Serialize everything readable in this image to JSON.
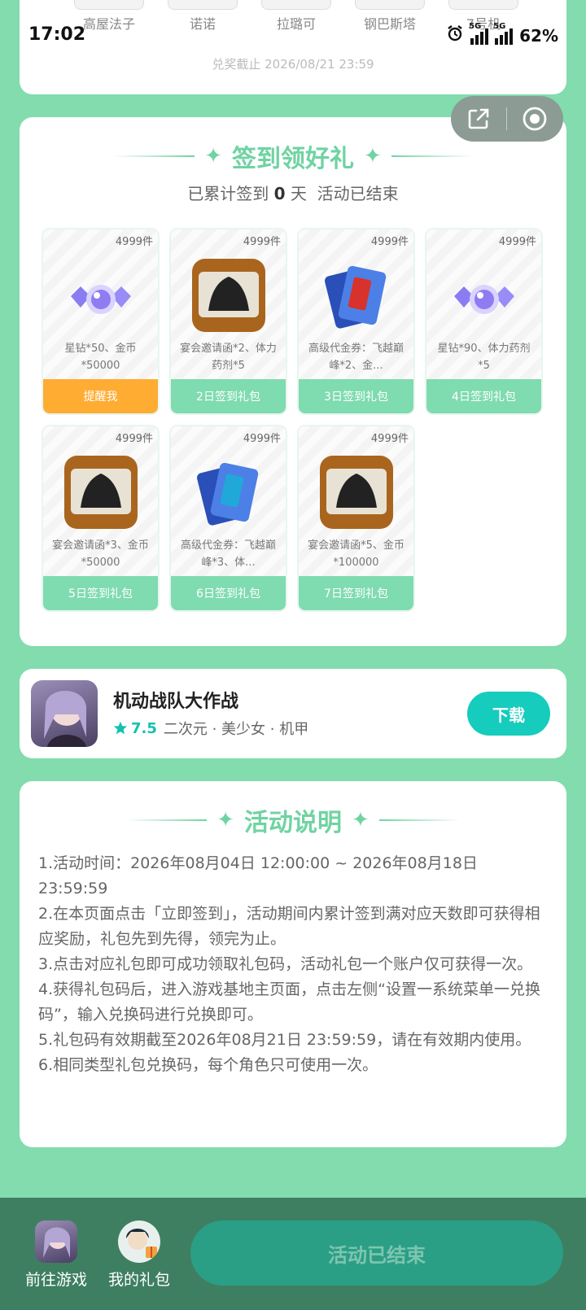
{
  "status_bar": {
    "time": "17:02",
    "battery": "62%",
    "network_tag_1": "5G",
    "network_tag_2": "5G"
  },
  "top_prizes": {
    "items": [
      "高屋法子",
      "诺诺",
      "拉璐可",
      "钢巴斯塔",
      "7号机"
    ],
    "deadline": "兑奖截止 2026/08/21 23:59"
  },
  "checkin": {
    "title": "签到领好礼",
    "sub_prefix": "已累计签到",
    "days": "0",
    "sub_unit": "天",
    "status": "活动已结束",
    "gifts": [
      {
        "count": "4999件",
        "desc": "星钻*50、金币*50000",
        "button": "提醒我",
        "icon": "diamond-icon"
      },
      {
        "count": "4999件",
        "desc": "宴会邀请函*2、体力药剂*5",
        "button": "2日签到礼包",
        "icon": "invitation-card-icon"
      },
      {
        "count": "4999件",
        "desc": "高级代金券：飞越巅峰*2、金...",
        "button": "3日签到礼包",
        "icon": "voucher-cards-icon"
      },
      {
        "count": "4999件",
        "desc": "星钻*90、体力药剂*5",
        "button": "4日签到礼包",
        "icon": "diamond-icon"
      },
      {
        "count": "4999件",
        "desc": "宴会邀请函*3、金币*50000",
        "button": "5日签到礼包",
        "icon": "invitation-card-icon"
      },
      {
        "count": "4999件",
        "desc": "高级代金券：飞越巅峰*3、体...",
        "button": "6日签到礼包",
        "icon": "voucher-cards-icon"
      },
      {
        "count": "4999件",
        "desc": "宴会邀请函*5、金币*100000",
        "button": "7日签到礼包",
        "icon": "invitation-card-icon"
      }
    ]
  },
  "game": {
    "name": "机动战队大作战",
    "rating": "7.5",
    "tags": "二次元 · 美少女 · 机甲",
    "download": "下载"
  },
  "rules": {
    "title": "活动说明",
    "items": [
      "1.活动时间：2026年08月04日 12:00:00 ~ 2026年08月18日 23:59:59",
      "2.在本页面点击「立即签到」，活动期间内累计签到满对应天数即可获得相应奖励，礼包先到先得，领完为止。",
      "3.点击对应礼包即可成功领取礼包码，活动礼包一个账户仅可获得一次。",
      "4.获得礼包码后，进入游戏基地主页面，点击左侧“设置一系统菜单一兑换码”，输入兑换码进行兑换即可。",
      "5.礼包码有效期截至2026年08月21日 23:59:59，请在有效期内使用。",
      "6.相同类型礼包兑换码，每个角色只可使用一次。"
    ]
  },
  "bottom": {
    "go_game": "前往游戏",
    "my_gifts": "我的礼包",
    "end_button": "活动已结束"
  },
  "colors": {
    "background": "#82dcad",
    "accent": "#6fd3a2",
    "remind": "#ffac33",
    "download": "#16ccbc",
    "bottom_bar": "#3e7f62"
  }
}
